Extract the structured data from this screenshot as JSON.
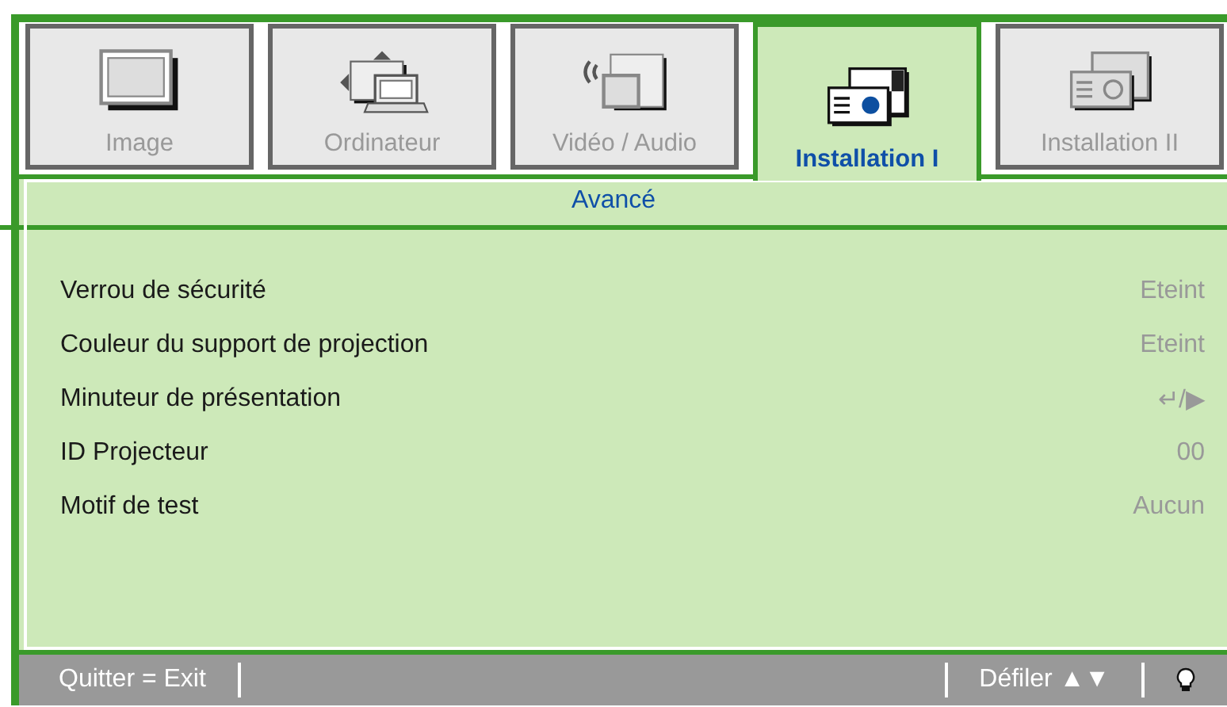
{
  "tabs": [
    {
      "label": "Image",
      "kind": "image",
      "selected": false
    },
    {
      "label": "Ordinateur",
      "kind": "computer",
      "selected": false
    },
    {
      "label": "Vidéo / Audio",
      "kind": "video",
      "selected": false
    },
    {
      "label": "Installation I",
      "kind": "setup1",
      "selected": true
    },
    {
      "label": "Installation II",
      "kind": "setup2",
      "selected": false
    }
  ],
  "panel": {
    "title": "Avancé",
    "rows": [
      {
        "label": "Verrou de sécurité",
        "value": "Eteint"
      },
      {
        "label": "Couleur du support de projection",
        "value": "Eteint"
      },
      {
        "label": "Minuteur de présentation",
        "value": "↵/▶"
      },
      {
        "label": "ID Projecteur",
        "value": "00"
      },
      {
        "label": "Motif de test",
        "value": "Aucun"
      }
    ]
  },
  "status_bar": {
    "left": "Quitter = Exit",
    "right": "Défiler ▲▼"
  }
}
